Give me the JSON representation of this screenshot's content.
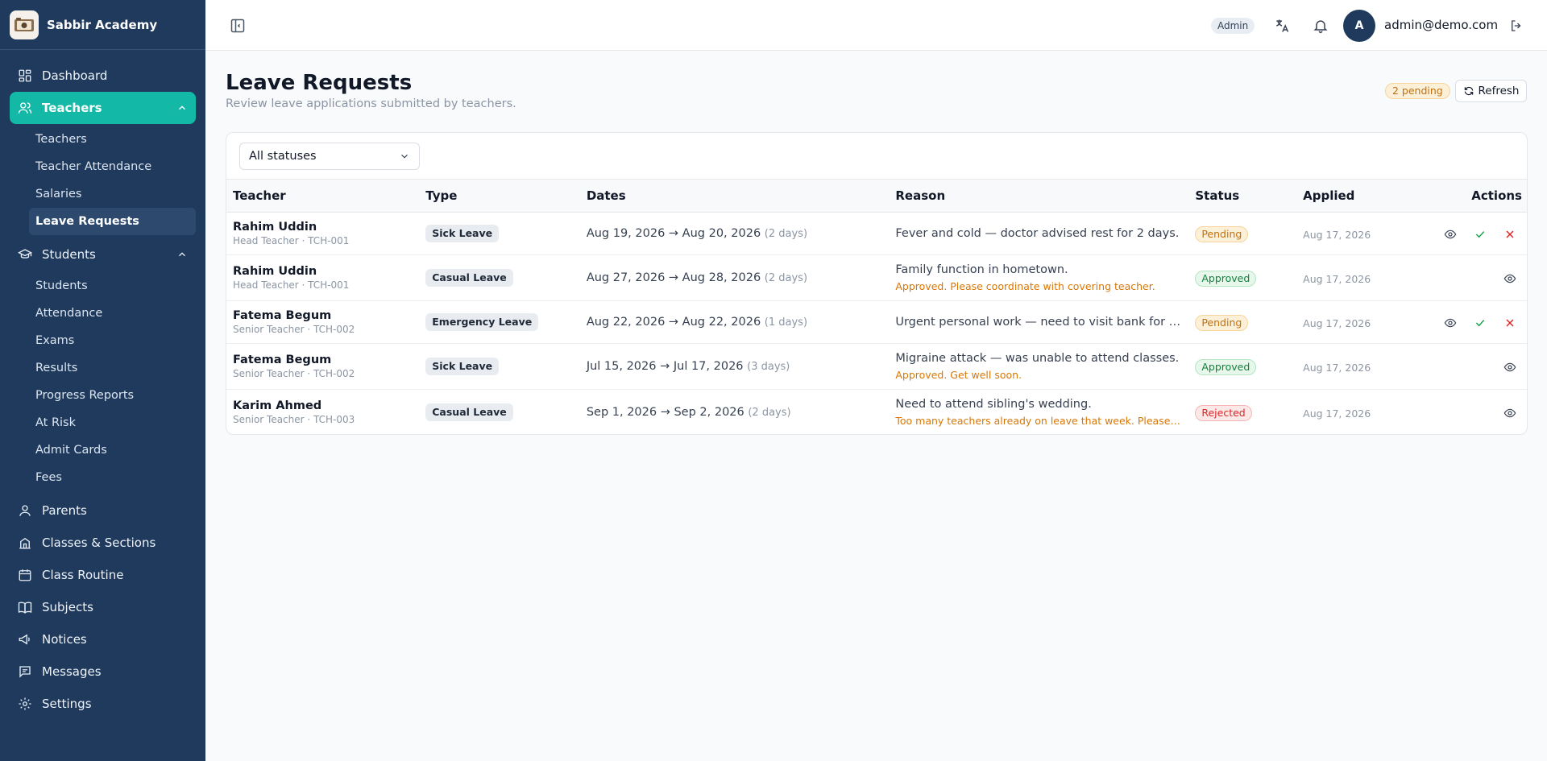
{
  "brand": {
    "name": "Sabbir Academy"
  },
  "sidebar": {
    "dashboard": "Dashboard",
    "teachers": "Teachers",
    "teachers_sub": [
      "Teachers",
      "Teacher Attendance",
      "Salaries",
      "Leave Requests"
    ],
    "students": "Students",
    "students_sub": [
      "Students",
      "Attendance",
      "Exams",
      "Results",
      "Progress Reports",
      "At Risk",
      "Admit Cards",
      "Fees"
    ],
    "parents": "Parents",
    "classes": "Classes & Sections",
    "routine": "Class Routine",
    "subjects": "Subjects",
    "notices": "Notices",
    "messages": "Messages",
    "settings": "Settings"
  },
  "header": {
    "role_badge": "Admin",
    "avatar_initial": "A",
    "email": "admin@demo.com"
  },
  "page": {
    "title": "Leave Requests",
    "subtitle": "Review leave applications submitted by teachers.",
    "pending_badge": "2 pending",
    "refresh_label": "Refresh"
  },
  "filter": {
    "value": "All statuses"
  },
  "table": {
    "headers": [
      "Teacher",
      "Type",
      "Dates",
      "Reason",
      "Status",
      "Applied",
      "Actions"
    ],
    "rows": [
      {
        "name": "Rahim Uddin",
        "meta": "Head Teacher · TCH-001",
        "type": "Sick Leave",
        "dates": "Aug 19, 2026 → Aug 20, 2026",
        "days": "(2 days)",
        "reason": "Fever and cold — doctor advised rest for 2 days.",
        "note": "",
        "status": "Pending",
        "applied": "Aug 17, 2026"
      },
      {
        "name": "Rahim Uddin",
        "meta": "Head Teacher · TCH-001",
        "type": "Casual Leave",
        "dates": "Aug 27, 2026 → Aug 28, 2026",
        "days": "(2 days)",
        "reason": "Family function in hometown.",
        "note": "Approved. Please coordinate with covering teacher.",
        "status": "Approved",
        "applied": "Aug 17, 2026"
      },
      {
        "name": "Fatema Begum",
        "meta": "Senior Teacher · TCH-002",
        "type": "Emergency Leave",
        "dates": "Aug 22, 2026 → Aug 22, 2026",
        "days": "(1 days)",
        "reason": "Urgent personal work — need to visit bank for property paperwork.",
        "note": "",
        "status": "Pending",
        "applied": "Aug 17, 2026"
      },
      {
        "name": "Fatema Begum",
        "meta": "Senior Teacher · TCH-002",
        "type": "Sick Leave",
        "dates": "Jul 15, 2026 → Jul 17, 2026",
        "days": "(3 days)",
        "reason": "Migraine attack — was unable to attend classes.",
        "note": "Approved. Get well soon.",
        "status": "Approved",
        "applied": "Aug 17, 2026"
      },
      {
        "name": "Karim Ahmed",
        "meta": "Senior Teacher · TCH-003",
        "type": "Casual Leave",
        "dates": "Sep 1, 2026 → Sep 2, 2026",
        "days": "(2 days)",
        "reason": "Need to attend sibling's wedding.",
        "note": "Too many teachers already on leave that week. Please plan another date.",
        "status": "Rejected",
        "applied": "Aug 17, 2026"
      }
    ]
  },
  "colors": {
    "sidebar_bg": "#1f3a5c",
    "accent": "#14b8a6",
    "pending": "#c2700a",
    "approved": "#15803d",
    "rejected": "#dc2626"
  }
}
